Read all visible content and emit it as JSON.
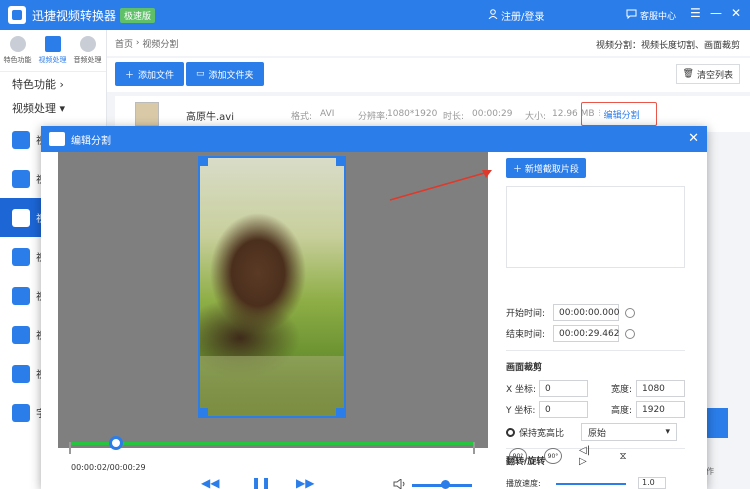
{
  "app": {
    "title": "迅捷视频转换器",
    "edition": "极速版",
    "login": "注册/登录",
    "service": "客服中心"
  },
  "topnav": [
    {
      "label": "特色功能"
    },
    {
      "label": "视频处理"
    },
    {
      "label": "音频处理"
    }
  ],
  "sidebar": {
    "group1": "特色功能",
    "group2": "视频处理",
    "items": [
      {
        "label": "视"
      },
      {
        "label": "视"
      },
      {
        "label": "视"
      },
      {
        "label": "视"
      },
      {
        "label": "视"
      },
      {
        "label": "视"
      },
      {
        "label": "视"
      },
      {
        "label": "字"
      }
    ]
  },
  "breadcrumb": {
    "home": "首页",
    "sep": "›",
    "current": "视频分割",
    "desc": "视频分割：视频长度切割、画面裁剪"
  },
  "toolbar": {
    "add_file": "添加文件",
    "add_folder": "添加文件夹",
    "clear": "清空列表"
  },
  "file": {
    "name": "高原牛.avi",
    "format_label": "格式:",
    "format": "AVI",
    "res_label": "分辨率:",
    "res": "1080*1920",
    "dur_label": "时长:",
    "dur": "00:00:29",
    "size_label": "大小:",
    "size": "12.96 MB",
    "edit": "编辑分割"
  },
  "dialog": {
    "title": "编辑分割",
    "add_segment": "新增截取片段",
    "start_label": "开始时间:",
    "start": "00:00:00.000",
    "end_label": "结束时间:",
    "end": "00:00:29.462",
    "crop_title": "画面裁剪",
    "x_label": "X 坐标:",
    "x": "0",
    "y_label": "Y 坐标:",
    "y": "0",
    "w_label": "宽度:",
    "w": "1080",
    "h_label": "高度:",
    "h": "1920",
    "keep_ratio": "保持宽高比",
    "ratio": "原始",
    "rotate_title": "翻转/旋转",
    "rot_left": "90°",
    "rot_right": "90°",
    "speed_label": "播放速度:",
    "speed": "1.0",
    "timecode": "00:00:02/00:00:29"
  },
  "right_peek": "作"
}
